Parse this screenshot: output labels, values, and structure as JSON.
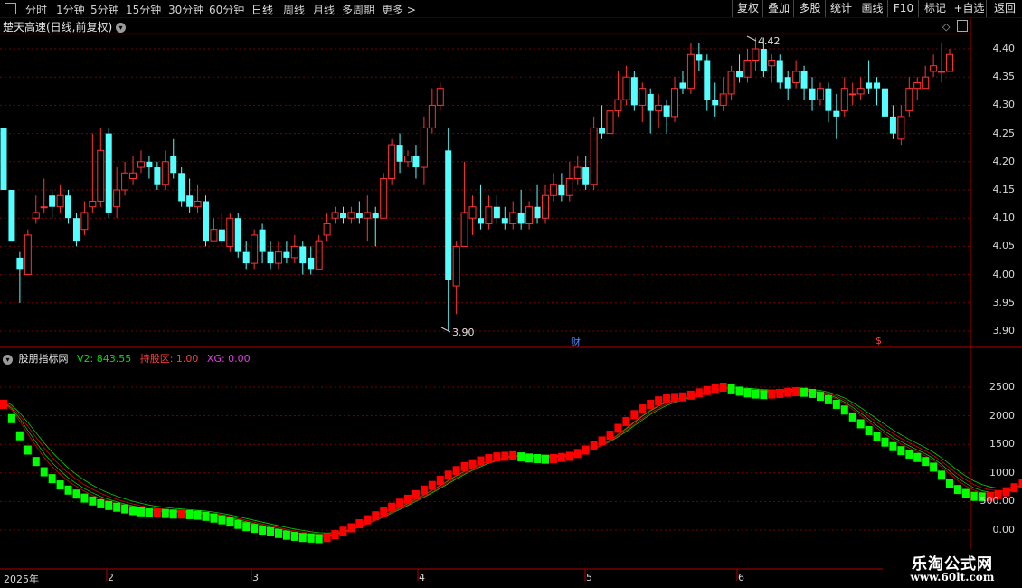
{
  "toolbar": {
    "periods": [
      "分时",
      "1分钟",
      "5分钟",
      "15分钟",
      "30分钟",
      "60分钟",
      "日线",
      "周线",
      "月线",
      "多周期",
      "更多"
    ],
    "active_period": "日线",
    "right_buttons": [
      "复权",
      "叠加",
      "多股",
      "统计",
      "画线",
      "F10",
      "标记",
      "+自选",
      "返回"
    ]
  },
  "stock": {
    "title": "楚天高速(日线,前复权)",
    "high_marker": "4.42",
    "low_marker": "3.90",
    "event_marker_1": "财",
    "event_marker_2": "$"
  },
  "indicator": {
    "name": "股朋指标网",
    "v2": "V2: 843.55",
    "hold": "持股区: 1.00",
    "xg": "XG: 0.00"
  },
  "price_axis": [
    "4.40",
    "4.35",
    "4.30",
    "4.25",
    "4.20",
    "4.15",
    "4.10",
    "4.05",
    "4.00",
    "3.95",
    "3.90"
  ],
  "ind_axis": [
    "2500",
    "2000",
    "1500",
    "1000",
    "500.00",
    "0.00"
  ],
  "dates": [
    "2025年",
    "2",
    "3",
    "4",
    "5",
    "6"
  ],
  "watermark": {
    "title": "乐淘公式网",
    "url": "www.60lt.com"
  },
  "colors": {
    "up": "#ff3232",
    "down": "#54ffff",
    "indicator_up": "#ff0000",
    "indicator_down": "#00ff00",
    "grid": "#8b0000"
  },
  "chart_data": {
    "type": "candlestick",
    "price_range": [
      3.9,
      4.42
    ],
    "candles": [
      [
        4.26,
        4.15,
        4.26,
        4.15
      ],
      [
        4.15,
        4.06,
        4.15,
        4.06
      ],
      [
        4.03,
        4.01,
        4.04,
        3.95
      ],
      [
        4.0,
        4.07,
        4.08,
        4.0
      ],
      [
        4.1,
        4.11,
        4.14,
        4.09
      ],
      [
        4.12,
        4.12,
        4.17,
        4.11
      ],
      [
        4.14,
        4.12,
        4.15,
        4.1
      ],
      [
        4.12,
        4.14,
        4.16,
        4.11
      ],
      [
        4.14,
        4.1,
        4.15,
        4.09
      ],
      [
        4.1,
        4.06,
        4.11,
        4.05
      ],
      [
        4.08,
        4.11,
        4.13,
        4.07
      ],
      [
        4.12,
        4.13,
        4.25,
        4.11
      ],
      [
        4.13,
        4.22,
        4.26,
        4.12
      ],
      [
        4.25,
        4.11,
        4.26,
        4.1
      ],
      [
        4.12,
        4.15,
        4.19,
        4.1
      ],
      [
        4.15,
        4.18,
        4.2,
        4.14
      ],
      [
        4.17,
        4.18,
        4.21,
        4.16
      ],
      [
        4.19,
        4.2,
        4.22,
        4.18
      ],
      [
        4.2,
        4.19,
        4.21,
        4.17
      ],
      [
        4.19,
        4.16,
        4.2,
        4.15
      ],
      [
        4.16,
        4.2,
        4.22,
        4.15
      ],
      [
        4.21,
        4.18,
        4.24,
        4.17
      ],
      [
        4.18,
        4.13,
        4.19,
        4.12
      ],
      [
        4.14,
        4.12,
        4.17,
        4.11
      ],
      [
        4.12,
        4.13,
        4.16,
        4.11
      ],
      [
        4.13,
        4.06,
        4.14,
        4.05
      ],
      [
        4.06,
        4.08,
        4.1,
        4.06
      ],
      [
        4.08,
        4.06,
        4.11,
        4.05
      ],
      [
        4.05,
        4.1,
        4.11,
        4.04
      ],
      [
        4.1,
        4.04,
        4.11,
        4.03
      ],
      [
        4.04,
        4.02,
        4.06,
        4.01
      ],
      [
        4.02,
        4.07,
        4.08,
        4.01
      ],
      [
        4.08,
        4.04,
        4.09,
        4.02
      ],
      [
        4.04,
        4.02,
        4.06,
        4.01
      ],
      [
        4.02,
        4.04,
        4.06,
        4.01
      ],
      [
        4.04,
        4.03,
        4.06,
        4.02
      ],
      [
        4.03,
        4.05,
        4.07,
        4.02
      ],
      [
        4.05,
        4.02,
        4.06,
        4.0
      ],
      [
        4.03,
        4.01,
        4.05,
        4.0
      ],
      [
        4.01,
        4.06,
        4.07,
        4.01
      ],
      [
        4.07,
        4.09,
        4.11,
        4.06
      ],
      [
        4.1,
        4.11,
        4.12,
        4.09
      ],
      [
        4.11,
        4.1,
        4.12,
        4.09
      ],
      [
        4.1,
        4.11,
        4.12,
        4.09
      ],
      [
        4.11,
        4.1,
        4.13,
        4.09
      ],
      [
        4.1,
        4.11,
        4.14,
        4.06
      ],
      [
        4.11,
        4.1,
        4.12,
        4.05
      ],
      [
        4.1,
        4.17,
        4.18,
        4.1
      ],
      [
        4.17,
        4.23,
        4.24,
        4.16
      ],
      [
        4.23,
        4.2,
        4.25,
        4.18
      ],
      [
        4.2,
        4.21,
        4.22,
        4.19
      ],
      [
        4.21,
        4.19,
        4.23,
        4.17
      ],
      [
        4.19,
        4.26,
        4.28,
        4.16
      ],
      [
        4.26,
        4.3,
        4.33,
        4.25
      ],
      [
        4.3,
        4.33,
        4.34,
        4.29
      ],
      [
        4.22,
        3.99,
        4.26,
        3.9
      ],
      [
        3.98,
        4.05,
        4.06,
        3.93
      ],
      [
        4.05,
        4.11,
        4.2,
        4.05
      ],
      [
        4.1,
        4.12,
        4.14,
        4.07
      ],
      [
        4.1,
        4.09,
        4.16,
        4.08
      ],
      [
        4.09,
        4.12,
        4.14,
        4.08
      ],
      [
        4.12,
        4.1,
        4.14,
        4.09
      ],
      [
        4.1,
        4.09,
        4.12,
        4.08
      ],
      [
        4.09,
        4.11,
        4.13,
        4.08
      ],
      [
        4.11,
        4.09,
        4.15,
        4.08
      ],
      [
        4.09,
        4.12,
        4.13,
        4.08
      ],
      [
        4.12,
        4.1,
        4.16,
        4.09
      ],
      [
        4.1,
        4.14,
        4.16,
        4.09
      ],
      [
        4.14,
        4.16,
        4.18,
        4.13
      ],
      [
        4.16,
        4.14,
        4.18,
        4.13
      ],
      [
        4.14,
        4.17,
        4.2,
        4.13
      ],
      [
        4.17,
        4.19,
        4.21,
        4.16
      ],
      [
        4.19,
        4.16,
        4.21,
        4.15
      ],
      [
        4.16,
        4.26,
        4.28,
        4.15
      ],
      [
        4.26,
        4.25,
        4.3,
        4.24
      ],
      [
        4.25,
        4.29,
        4.33,
        4.24
      ],
      [
        4.29,
        4.31,
        4.36,
        4.28
      ],
      [
        4.31,
        4.35,
        4.37,
        4.3
      ],
      [
        4.35,
        4.3,
        4.36,
        4.29
      ],
      [
        4.3,
        4.33,
        4.34,
        4.27
      ],
      [
        4.32,
        4.29,
        4.33,
        4.25
      ],
      [
        4.29,
        4.3,
        4.32,
        4.26
      ],
      [
        4.3,
        4.28,
        4.31,
        4.25
      ],
      [
        4.28,
        4.33,
        4.35,
        4.27
      ],
      [
        4.34,
        4.33,
        4.36,
        4.32
      ],
      [
        4.33,
        4.39,
        4.41,
        4.32
      ],
      [
        4.39,
        4.38,
        4.41,
        4.36
      ],
      [
        4.38,
        4.31,
        4.39,
        4.29
      ],
      [
        4.31,
        4.3,
        4.34,
        4.28
      ],
      [
        4.3,
        4.32,
        4.35,
        4.29
      ],
      [
        4.32,
        4.36,
        4.37,
        4.31
      ],
      [
        4.36,
        4.35,
        4.39,
        4.34
      ],
      [
        4.35,
        4.38,
        4.4,
        4.34
      ],
      [
        4.38,
        4.4,
        4.42,
        4.36
      ],
      [
        4.4,
        4.36,
        4.42,
        4.35
      ],
      [
        4.37,
        4.38,
        4.39,
        4.34
      ],
      [
        4.38,
        4.34,
        4.39,
        4.33
      ],
      [
        4.35,
        4.33,
        4.36,
        4.31
      ],
      [
        4.34,
        4.36,
        4.38,
        4.33
      ],
      [
        4.36,
        4.33,
        4.37,
        4.31
      ],
      [
        4.33,
        4.31,
        4.35,
        4.29
      ],
      [
        4.31,
        4.33,
        4.34,
        4.3
      ],
      [
        4.33,
        4.29,
        4.34,
        4.27
      ],
      [
        4.29,
        4.28,
        4.32,
        4.24
      ],
      [
        4.29,
        4.33,
        4.35,
        4.28
      ],
      [
        4.32,
        4.32,
        4.34,
        4.3
      ],
      [
        4.32,
        4.33,
        4.35,
        4.31
      ],
      [
        4.34,
        4.33,
        4.38,
        4.32
      ],
      [
        4.34,
        4.33,
        4.35,
        4.3
      ],
      [
        4.33,
        4.28,
        4.34,
        4.26
      ],
      [
        4.28,
        4.25,
        4.3,
        4.24
      ],
      [
        4.24,
        4.28,
        4.3,
        4.23
      ],
      [
        4.29,
        4.33,
        4.35,
        4.28
      ],
      [
        4.33,
        4.34,
        4.35,
        4.31
      ],
      [
        4.33,
        4.35,
        4.37,
        4.33
      ],
      [
        4.36,
        4.37,
        4.39,
        4.35
      ],
      [
        4.36,
        4.36,
        4.41,
        4.34
      ],
      [
        4.36,
        4.39,
        4.4,
        4.36
      ]
    ],
    "indicator_values": [
      2200,
      1950,
      1650,
      1400,
      1200,
      1020,
      900,
      790,
      700,
      630,
      560,
      510,
      460,
      430,
      400,
      370,
      340,
      320,
      300,
      300,
      290,
      280,
      280,
      270,
      260,
      240,
      210,
      180,
      140,
      100,
      60,
      30,
      0,
      -30,
      -60,
      -90,
      -110,
      -130,
      -140,
      -150,
      -130,
      -80,
      -20,
      40,
      110,
      180,
      250,
      320,
      400,
      470,
      540,
      620,
      700,
      780,
      870,
      960,
      1040,
      1110,
      1160,
      1210,
      1250,
      1280,
      1290,
      1300,
      1280,
      1260,
      1250,
      1240,
      1250,
      1270,
      1290,
      1340,
      1400,
      1480,
      1560,
      1660,
      1780,
      1900,
      2020,
      2120,
      2200,
      2260,
      2300,
      2320,
      2330,
      2360,
      2400,
      2440,
      2480,
      2500,
      2470,
      2430,
      2400,
      2380,
      2370,
      2380,
      2390,
      2410,
      2420,
      2410,
      2390,
      2340,
      2280,
      2200,
      2100,
      1980,
      1860,
      1740,
      1640,
      1540,
      1460,
      1390,
      1330,
      1270,
      1200,
      1100,
      960,
      820,
      710,
      640,
      590,
      580,
      590,
      620,
      670,
      740,
      820
    ],
    "indicator_range": [
      -100,
      2950
    ]
  }
}
